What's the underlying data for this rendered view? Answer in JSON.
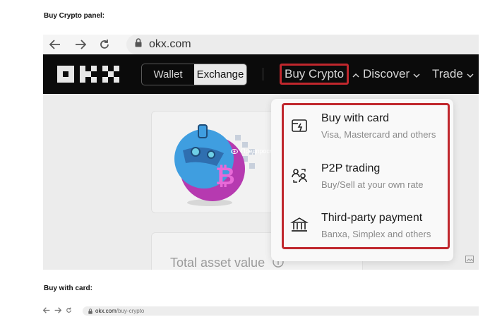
{
  "captions": {
    "first": "Buy Crypto panel:",
    "second": "Buy with card:"
  },
  "browser": {
    "url": "okx.com"
  },
  "topbar": {
    "toggle": {
      "wallet": "Wallet",
      "exchange": "Exchange",
      "selected": "Exchange"
    },
    "nav": {
      "buy_crypto": "Buy Crypto",
      "discover": "Discover",
      "trade": "Trade"
    }
  },
  "content": {
    "asset_label": "Total asset value",
    "preview_label": "Предпросмотр"
  },
  "dropdown": {
    "items": [
      {
        "title": "Buy with card",
        "subtitle": "Visa, Mastercard and others",
        "icon": "card-icon"
      },
      {
        "title": "P2P trading",
        "subtitle": "Buy/Sell at your own rate",
        "icon": "p2p-icon"
      },
      {
        "title": "Third-party payment",
        "subtitle": "Banxa, Simplex and others",
        "icon": "bank-icon"
      }
    ]
  },
  "browser2": {
    "domain": "okx.com",
    "path": "/buy-crypto"
  },
  "colors": {
    "highlight": "#c0272d",
    "topbar": "#0b0b0b"
  }
}
